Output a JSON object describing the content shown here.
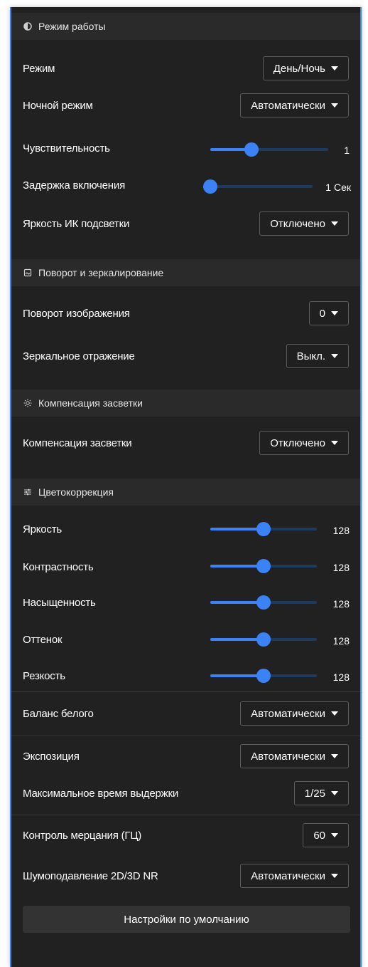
{
  "colors": {
    "accent": "#3b82f6",
    "panel_bg": "#212121",
    "header_bg": "#2a2a2a"
  },
  "sections": {
    "mode": {
      "title": "Режим работы",
      "icon": "half-circle-icon"
    },
    "rotation": {
      "title": "Поворот и зеркалирование",
      "icon": "image-rotate-icon"
    },
    "backlight": {
      "title": "Компенсация засветки",
      "icon": "sun-icon"
    },
    "color": {
      "title": "Цветокоррекция",
      "icon": "sliders-icon"
    }
  },
  "rows": {
    "mode": {
      "label": "Режим",
      "value": "День/Ночь"
    },
    "night_mode": {
      "label": "Ночной режим",
      "value": "Автоматически"
    },
    "sensitivity": {
      "label": "Чувствительность",
      "value": "1",
      "fraction": 0.35
    },
    "delay": {
      "label": "Задержка включения",
      "value": "1 Сек",
      "fraction": 0.0
    },
    "ir_brightness": {
      "label": "Яркость ИК подсветки",
      "value": "Отключено"
    },
    "rotation": {
      "label": "Поворот изображения",
      "value": "0"
    },
    "mirror": {
      "label": "Зеркальное отражение",
      "value": "Выкл."
    },
    "blc": {
      "label": "Компенсация засветки",
      "value": "Отключено"
    },
    "brightness": {
      "label": "Яркость",
      "value": "128",
      "fraction": 0.5
    },
    "contrast": {
      "label": "Контрастность",
      "value": "128",
      "fraction": 0.5
    },
    "saturation": {
      "label": "Насыщенность",
      "value": "128",
      "fraction": 0.5
    },
    "hue": {
      "label": "Оттенок",
      "value": "128",
      "fraction": 0.5
    },
    "sharpness": {
      "label": "Резкость",
      "value": "128",
      "fraction": 0.5
    },
    "white_balance": {
      "label": "Баланс белого",
      "value": "Автоматически"
    },
    "exposure": {
      "label": "Экспозиция",
      "value": "Автоматически"
    },
    "max_shutter": {
      "label": "Максимальное время выдержки",
      "value": "1/25"
    },
    "flicker": {
      "label": "Контроль мерцания (ГЦ)",
      "value": "60"
    },
    "nr": {
      "label": "Шумоподавление 2D/3D NR",
      "value": "Автоматически"
    }
  },
  "reset_label": "Настройки по умолчанию"
}
